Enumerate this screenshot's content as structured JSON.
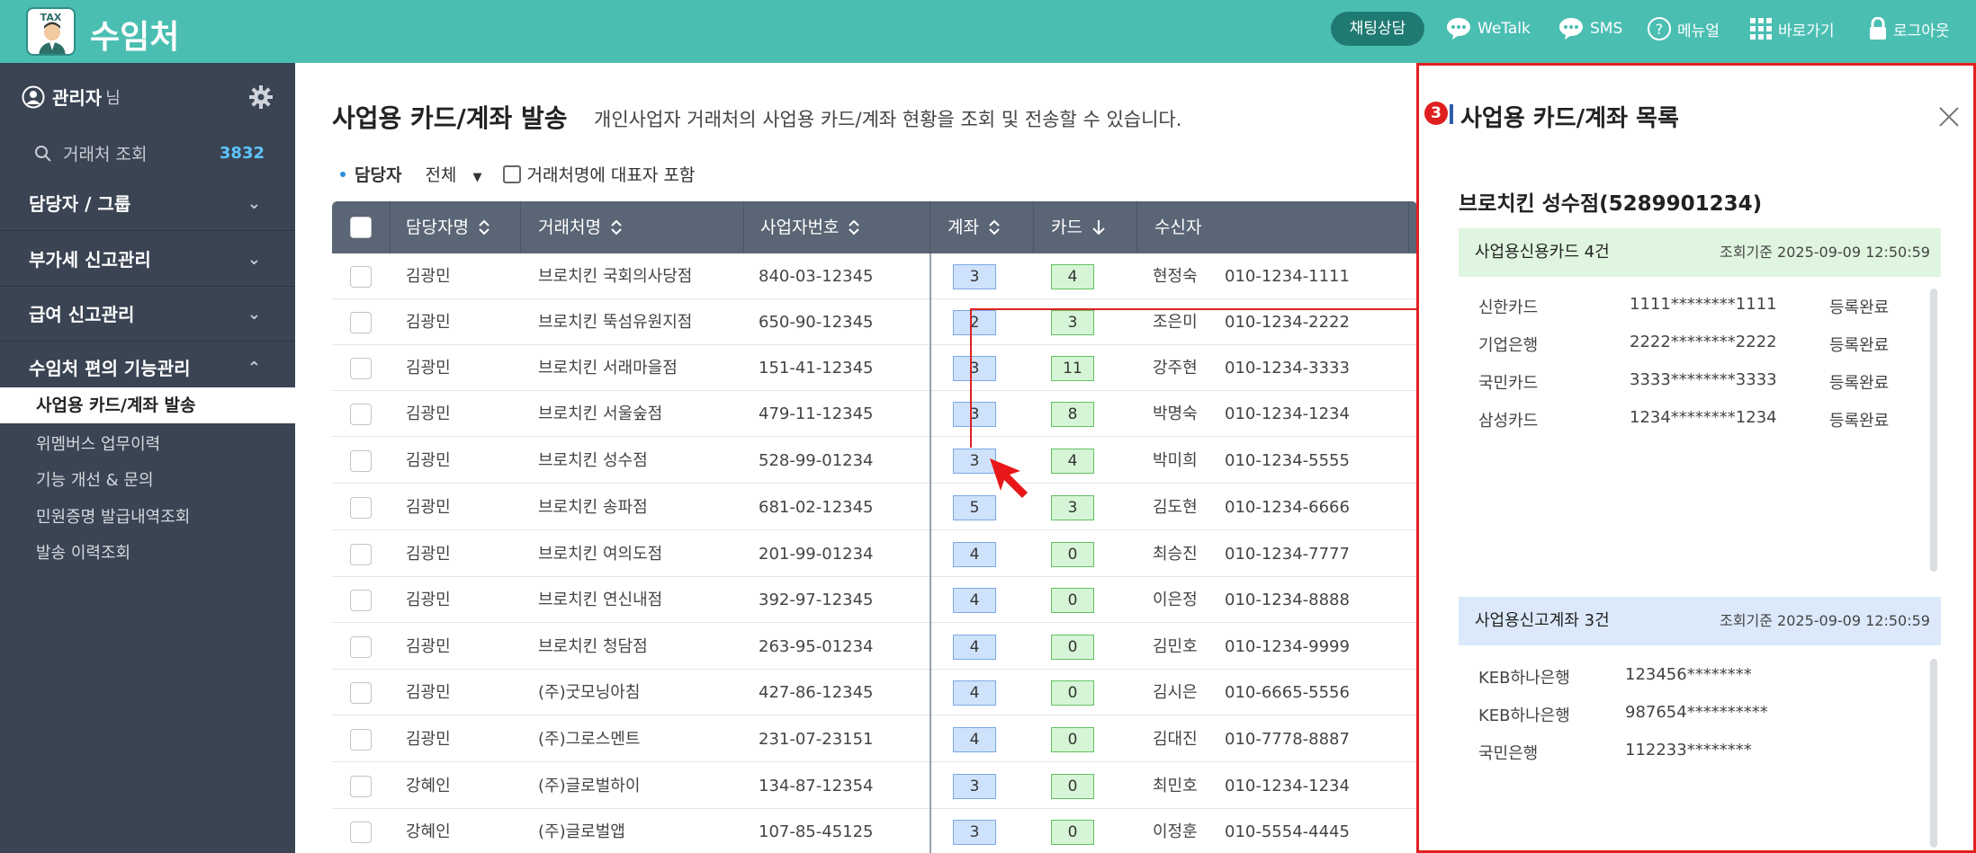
{
  "header": {
    "logo_badge": "TAX",
    "app_title": "수임처",
    "chat_button": "채팅상담",
    "nav": [
      {
        "icon": "chat-bubble-icon",
        "label": "WeTalk"
      },
      {
        "icon": "sms-bubble-icon",
        "label": "SMS"
      },
      {
        "icon": "help-circle-icon",
        "label": "메뉴얼"
      },
      {
        "icon": "grid-icon",
        "label": "바로가기"
      },
      {
        "icon": "lock-icon",
        "label": "로그아웃"
      }
    ]
  },
  "sidebar": {
    "user_name": "관리자",
    "user_suffix": "님",
    "search_label": "거래처 조회",
    "search_count": "3832",
    "sections": [
      {
        "label": "담당자 / 그룹",
        "expanded": false
      },
      {
        "label": "부가세 신고관리",
        "expanded": false
      },
      {
        "label": "급여 신고관리",
        "expanded": false
      },
      {
        "label": "수임처 편의 기능관리",
        "expanded": true
      }
    ],
    "active_item": "사업용 카드/계좌 발송",
    "sub_items": [
      "위멤버스 업무이력",
      "기능 개선 & 문의",
      "민원증명 발급내역조회",
      "발송 이력조회"
    ]
  },
  "main": {
    "title": "사업용 카드/계좌 발송",
    "description": "개인사업자 거래처의 사업용 카드/계좌 현황을 조회 및 전송할 수 있습니다.",
    "filter": {
      "label": "담당자",
      "selected": "전체",
      "checkbox_label": "거래처명에 대표자 포함"
    },
    "columns": [
      "담당자명",
      "거래처명",
      "사업자번호",
      "계좌",
      "카드",
      "수신자"
    ],
    "rows": [
      {
        "manager": "김광민",
        "client": "브로치킨 국회의사당점",
        "bizno": "840-03-12345",
        "account": "3",
        "card": "4",
        "receiver": "현정숙",
        "phone": "010-1234-1111"
      },
      {
        "manager": "김광민",
        "client": "브로치킨 뚝섬유원지점",
        "bizno": "650-90-12345",
        "account": "2",
        "card": "3",
        "receiver": "조은미",
        "phone": "010-1234-2222"
      },
      {
        "manager": "김광민",
        "client": "브로치킨 서래마을점",
        "bizno": "151-41-12345",
        "account": "3",
        "card": "11",
        "receiver": "강주현",
        "phone": "010-1234-3333"
      },
      {
        "manager": "김광민",
        "client": "브로치킨 서울숲점",
        "bizno": "479-11-12345",
        "account": "3",
        "card": "8",
        "receiver": "박명숙",
        "phone": "010-1234-1234"
      },
      {
        "manager": "김광민",
        "client": "브로치킨 성수점",
        "bizno": "528-99-01234",
        "account": "3",
        "card": "4",
        "receiver": "박미희",
        "phone": "010-1234-5555"
      },
      {
        "manager": "김광민",
        "client": "브로치킨 송파점",
        "bizno": "681-02-12345",
        "account": "5",
        "card": "3",
        "receiver": "김도현",
        "phone": "010-1234-6666"
      },
      {
        "manager": "김광민",
        "client": "브로치킨 여의도점",
        "bizno": "201-99-01234",
        "account": "4",
        "card": "0",
        "receiver": "최승진",
        "phone": "010-1234-7777"
      },
      {
        "manager": "김광민",
        "client": "브로치킨 연신내점",
        "bizno": "392-97-12345",
        "account": "4",
        "card": "0",
        "receiver": "이은정",
        "phone": "010-1234-8888"
      },
      {
        "manager": "김광민",
        "client": "브로치킨 청담점",
        "bizno": "263-95-01234",
        "account": "4",
        "card": "0",
        "receiver": "김민호",
        "phone": "010-1234-9999"
      },
      {
        "manager": "김광민",
        "client": "(주)굿모닝아침",
        "bizno": "427-86-12345",
        "account": "4",
        "card": "0",
        "receiver": "김시은",
        "phone": "010-6665-5556"
      },
      {
        "manager": "김광민",
        "client": "(주)그로스멘트",
        "bizno": "231-07-23151",
        "account": "4",
        "card": "0",
        "receiver": "김대진",
        "phone": "010-7778-8887"
      },
      {
        "manager": "강혜인",
        "client": "(주)글로벌하이",
        "bizno": "134-87-12354",
        "account": "3",
        "card": "0",
        "receiver": "최민호",
        "phone": "010-1234-1234"
      },
      {
        "manager": "강혜인",
        "client": "(주)글로벌앱",
        "bizno": "107-85-45125",
        "account": "3",
        "card": "0",
        "receiver": "이정훈",
        "phone": "010-5554-4445"
      }
    ]
  },
  "panel": {
    "step_number": "3",
    "title": "사업용 카드/계좌 목록",
    "company": "브로치킨 성수점(5289901234)",
    "cards_header": "사업용신용카드 4건",
    "cards_timestamp": "조회기준 2025-09-09 12:50:59",
    "cards": [
      {
        "name": "신한카드",
        "number": "1111********1111",
        "status": "등록완료"
      },
      {
        "name": "기업은행",
        "number": "2222********2222",
        "status": "등록완료"
      },
      {
        "name": "국민카드",
        "number": "3333********3333",
        "status": "등록완료"
      },
      {
        "name": "삼성카드",
        "number": "1234********1234",
        "status": "등록완료"
      }
    ],
    "accounts_header": "사업용신고계좌 3건",
    "accounts_timestamp": "조회기준 2025-09-09 12:50:59",
    "accounts": [
      {
        "bank": "KEB하나은행",
        "number": "123456********"
      },
      {
        "bank": "KEB하나은행",
        "number": "987654**********"
      },
      {
        "bank": "국민은행",
        "number": "112233********"
      }
    ]
  },
  "colors": {
    "header_bg": "#4bbeb2",
    "sidebar_bg": "#3a4453",
    "table_header_bg": "#5a6575",
    "highlight_red": "#e02020",
    "cards_band": "#dff5df",
    "accounts_band": "#dbe9fb"
  }
}
